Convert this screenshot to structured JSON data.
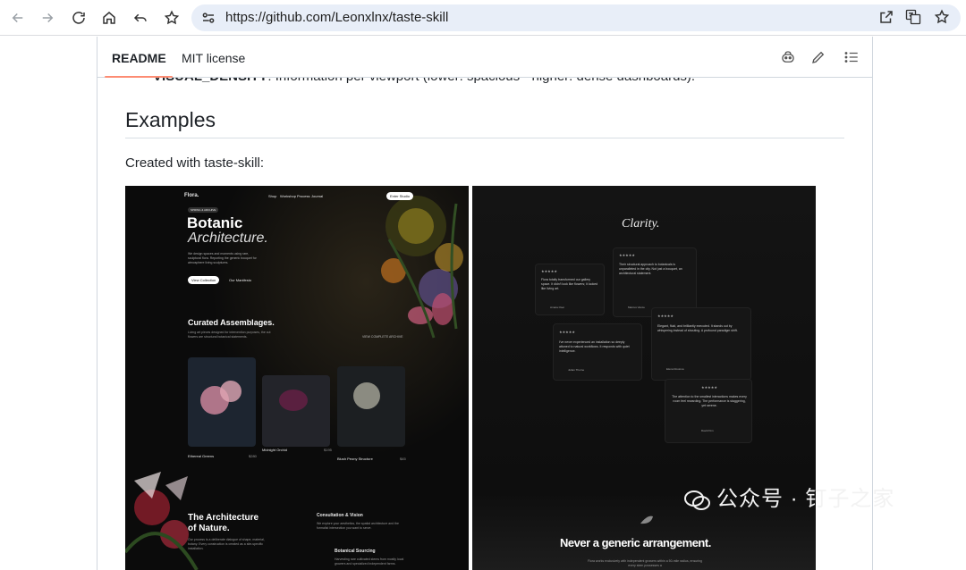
{
  "browser": {
    "url": "https://github.com/Leonxlnx/taste-skill",
    "icons": [
      "back-icon",
      "forward-icon",
      "reload-icon",
      "home-icon",
      "undo-icon",
      "bookmark-star-icon",
      "site-settings-icon",
      "open-external-icon",
      "translate-icon",
      "star-icon"
    ]
  },
  "readme": {
    "tabs": [
      {
        "label": "README"
      },
      {
        "label": "MIT license"
      }
    ],
    "clipped_line_bold": "VISUAL_DENSITY",
    "clipped_line_rest": ": Information per viewport (lower: spacious - higher: dense dashboards).",
    "heading": "Examples",
    "paragraph": "Created with taste-skill:"
  },
  "left_shot": {
    "brand": "Flora.",
    "nav": [
      "Shop",
      "Workshop",
      "Process",
      "Journal"
    ],
    "cta": "Enter Studio",
    "badge": "SPRING & ARCHIVE",
    "title1": "Botanic",
    "title2": "Architecture.",
    "blurb": "We design spaces and moments using rare, sculptural flora. Reporting the generic bouquet for atmosphere living sculptures.",
    "btn1": "View Collection",
    "btn2": "Our Manifesto",
    "section_title": "Curated Assemblages.",
    "section_sub": "Living art pieces designed for intervention purposes, the cut flowers are structural botanical statements.",
    "view_all": "VIEW COMPLETE ARCHIVE",
    "products": [
      {
        "name": "Ethereal Greens",
        "price": "$280"
      },
      {
        "name": "Midnight Orchid",
        "price": "$195"
      },
      {
        "name": "Blush Peony Structure",
        "price": "$45"
      }
    ],
    "bottom_title1": "The Architecture",
    "bottom_title2": "of Nature.",
    "bottom_sub": "Our process is a deliberate dialogue of shape, material, botany. Every construction is created as a site-specific installation.",
    "service1": "Consultation & Vision",
    "service1_sub": "We explore your aesthetics, the spatial architecture and the formalist intersection you want to serve.",
    "service2": "Botanical Sourcing",
    "service2_sub": "Harvesting rare cultivated stems from mostly local growers and specialized independent farms."
  },
  "right_shot": {
    "title": "Clarity.",
    "testimonials": [
      {
        "stars": "★★★★★",
        "text": "Flora totally transformed our gallery space. It didn't look like flowers; it looked like living art.",
        "name": "Amara Osei"
      },
      {
        "stars": "★★★★★",
        "text": "Their structural approach to botanicals is unparalleled in the city. Not just a bouquet, an architectural statement.",
        "name": "Marcus Vance"
      },
      {
        "stars": "★★★★★",
        "text": "Elegant, fluid, and brilliantly executed. It stands out by whispering instead of shouting. A profound paradigm shift.",
        "name": "Elena Rostova"
      },
      {
        "stars": "★★★★★",
        "text": "I've never experienced an installation so deeply attuned to natural workflows. It responds with quiet intelligence.",
        "name": "Julian Thorne"
      },
      {
        "stars": "★★★★★",
        "text": "The attention to the smallest interactions makes every room feel rewarding. The performance is staggering, yet serene.",
        "name": "David Kim"
      }
    ],
    "bottom_title": "Never a generic arrangement.",
    "bottom_sub": "Flora works exclusively with independent growers within a 50-mile radius, ensuring every stem possesses a"
  },
  "watermark": "公众号 · 钉子之家"
}
